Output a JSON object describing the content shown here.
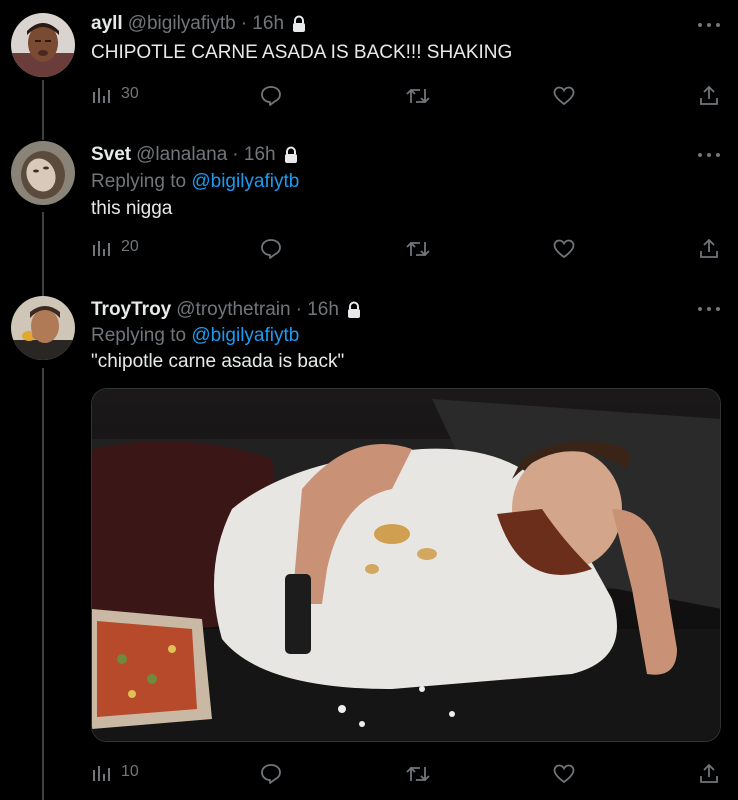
{
  "tweets": [
    {
      "name": "ayll",
      "handle": "@bigilyafiytb",
      "time": "· 16h",
      "text": "CHIPOTLE CARNE ASADA IS BACK!!! SHAKING",
      "views": "30",
      "avatar_icon": "avatar-photo-icon"
    },
    {
      "name": "Svet",
      "handle": "@lanalana",
      "time": "· 16h",
      "replying_prefix": "Replying to",
      "replying_handle": "@bigilyafiytb",
      "text": "this nigga",
      "views": "20",
      "avatar_icon": "avatar-photo-icon"
    },
    {
      "name": "TroyTroy",
      "handle": "@troythetrain",
      "time": "· 16h",
      "replying_prefix": "Replying to",
      "replying_handle": "@bigilyafiytb",
      "text": "\"chipotle carne asada is back\"",
      "views": "10",
      "avatar_icon": "avatar-photo-icon",
      "media_icon": "man-on-couch-with-pizza-image"
    }
  ],
  "icons": {
    "views": "bar-chart-icon",
    "reply": "speech-bubble-icon",
    "retweet": "retweet-icon",
    "like": "heart-icon",
    "share": "share-upload-icon",
    "lock": "lock-icon",
    "more": "more-dots-icon"
  },
  "colors": {
    "background": "#000000",
    "text": "#e7e9ea",
    "muted": "#71767b",
    "mention": "#1d9bf0",
    "thread_line": "#3e4144"
  }
}
